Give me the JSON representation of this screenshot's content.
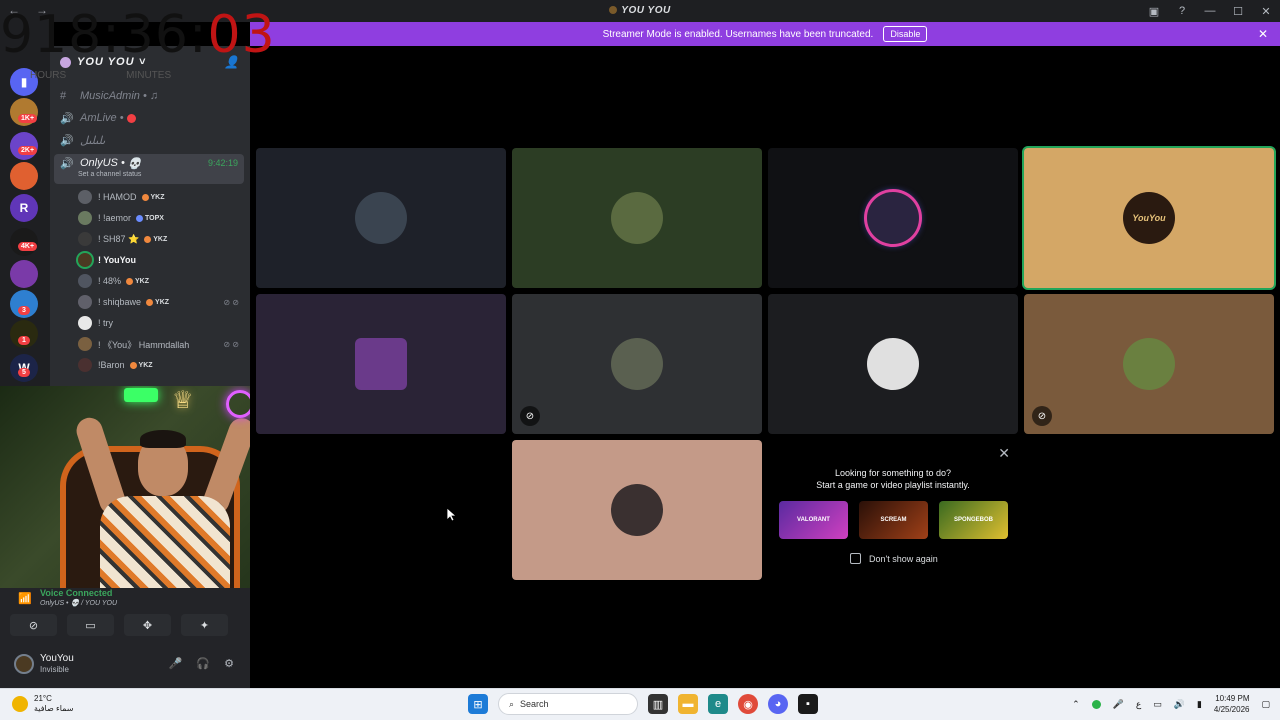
{
  "window": {
    "title": "YOU YOU",
    "back": "←",
    "forward": "→"
  },
  "timer": {
    "hours": "918",
    "sep1": ":",
    "minutes": "36",
    "sep2": ":",
    "seconds": "03",
    "label_hours": "HOURS",
    "label_minutes": "MINUTES"
  },
  "banner": {
    "text": "Streamer Mode is enabled. Usernames have been truncated.",
    "disable_label": "Disable"
  },
  "rail": {
    "badges": [
      "1K+",
      "2K+",
      "4K+",
      "3",
      "1",
      "5"
    ]
  },
  "sidebar": {
    "server_name": "YOU YOU",
    "channels": [
      {
        "name": "MusicAdmin •",
        "icon": "hash-icon"
      },
      {
        "name": "AmLive •",
        "icon": "speaker-icon"
      },
      {
        "name": "ىلىلىل",
        "icon": "speaker-icon"
      },
      {
        "name": "OnlyUS •",
        "icon": "speaker-icon",
        "time": "9:42:19",
        "status": "Set a channel status"
      }
    ],
    "members": [
      {
        "name": "! HAMOD",
        "tag": "YKZ"
      },
      {
        "name": "! !aemor",
        "tag": "TOPX"
      },
      {
        "name": "! SH87",
        "tag": "YKZ"
      },
      {
        "name": "! YouYou",
        "tag": ""
      },
      {
        "name": "! 48%",
        "tag": "YKZ"
      },
      {
        "name": "! shiqbawe",
        "tag": "YKZ"
      },
      {
        "name": "! try",
        "tag": ""
      },
      {
        "name": "! 《You》 Hammdallah",
        "tag": ""
      },
      {
        "name": "!Baron",
        "tag": "YKZ"
      }
    ]
  },
  "voice": {
    "title": "Voice Connected",
    "subtitle": "OnlyUS • 💀 / YOU YOU"
  },
  "user": {
    "name": "YouYou",
    "status": "Invisible"
  },
  "activity": {
    "line1": "Looking for something to do?",
    "line2": "Start a game or video playlist instantly.",
    "cards": [
      "VALORANT",
      "SCREAM",
      "SPONGEBOB"
    ],
    "checkbox_label": "Don't show again"
  },
  "tiles": {
    "avatar4_text": "YouYou"
  },
  "taskbar": {
    "temp": "21°C",
    "weather": "سماء صافية",
    "search": "Search",
    "lang": "ع",
    "time": "10:49 PM",
    "date": "4/25/2026"
  },
  "colors": {
    "banner": "#8f3ee0",
    "speaking": "#23a55a",
    "sidebar": "#2b2d31"
  }
}
